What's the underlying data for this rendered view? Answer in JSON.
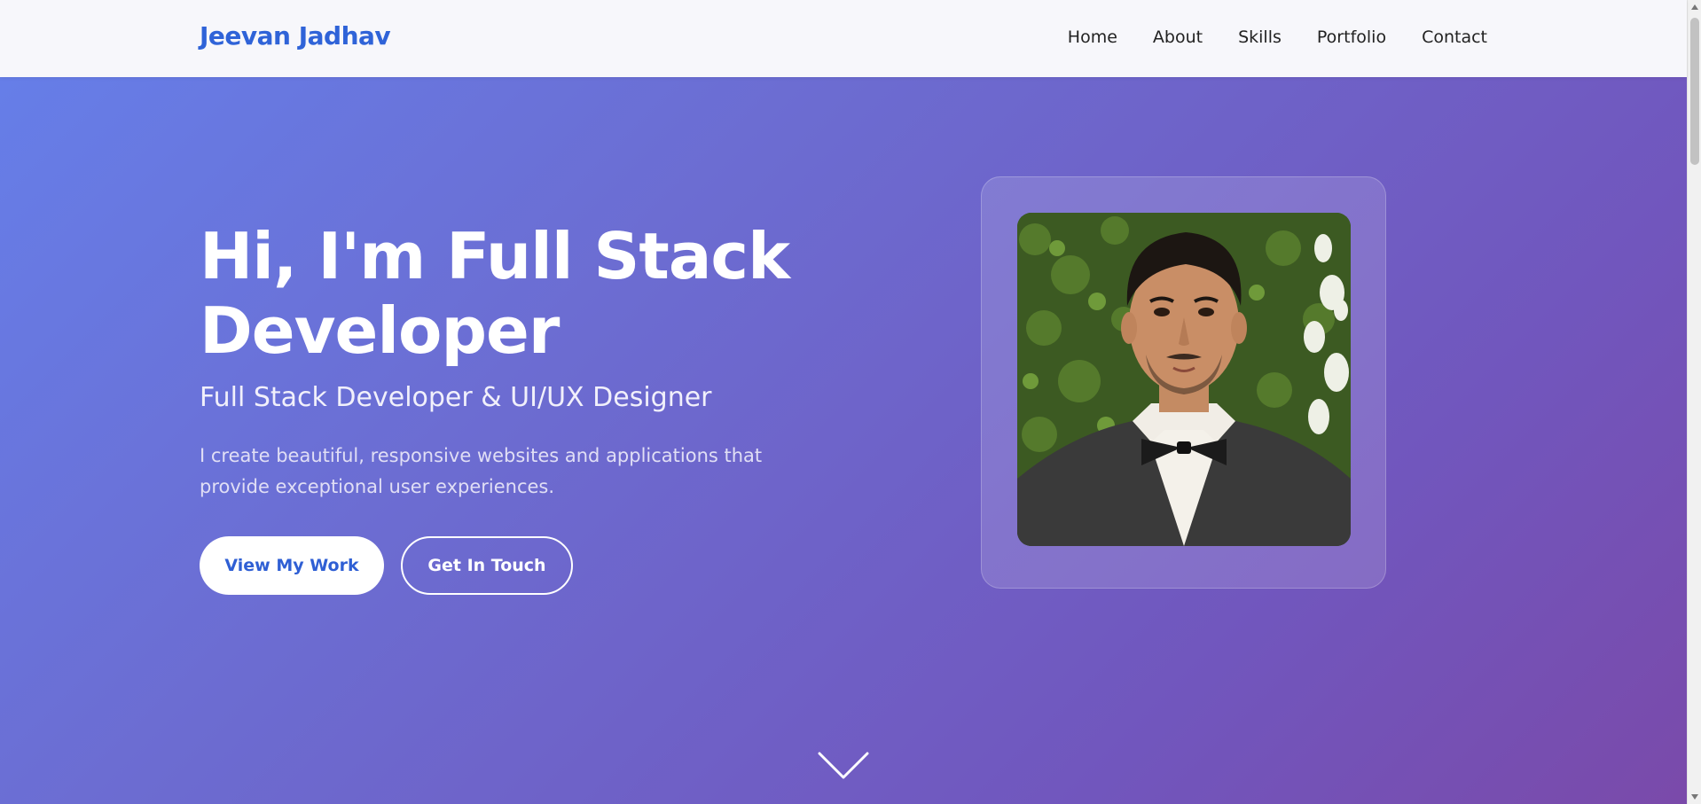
{
  "brand": "Jeevan Jadhav",
  "nav": {
    "items": [
      "Home",
      "About",
      "Skills",
      "Portfolio",
      "Contact"
    ]
  },
  "hero": {
    "title": "Hi, I'm Full Stack Developer",
    "subtitle": "Full Stack Developer & UI/UX Designer",
    "description": "I create beautiful, responsive websites and applications that provide exceptional user experiences.",
    "primary_button": "View My Work",
    "secondary_button": "Get In Touch"
  },
  "icons": {
    "scroll_down": "chevron-down-icon"
  },
  "colors": {
    "brand": "#2f63d8",
    "hero_gradient_start": "#667ee8",
    "hero_gradient_end": "#7a4aaa",
    "navbar_bg": "#f7f7fb"
  }
}
